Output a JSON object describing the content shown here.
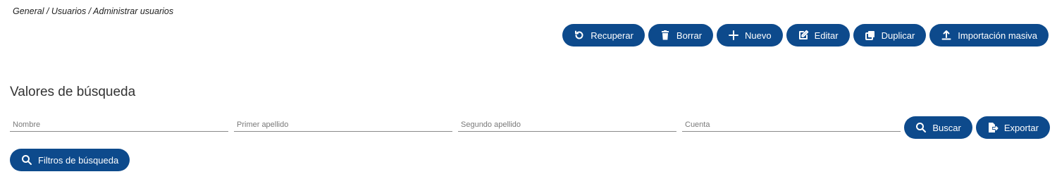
{
  "breadcrumb": "General / Usuarios / Administrar usuarios",
  "toolbar": {
    "recover": "Recuperar",
    "delete": "Borrar",
    "new": "Nuevo",
    "edit": "Editar",
    "duplicate": "Duplicar",
    "import": "Importación masiva"
  },
  "search": {
    "title": "Valores de búsqueda",
    "fields": {
      "nombre": "Nombre",
      "primer_apellido": "Primer apellido",
      "segundo_apellido": "Segundo apellido",
      "cuenta": "Cuenta"
    },
    "search_button": "Buscar",
    "export_button": "Exportar",
    "filters_button": "Filtros de búsqueda"
  },
  "colors": {
    "button_bg": "#0d4a8c",
    "button_text": "#ffffff"
  }
}
